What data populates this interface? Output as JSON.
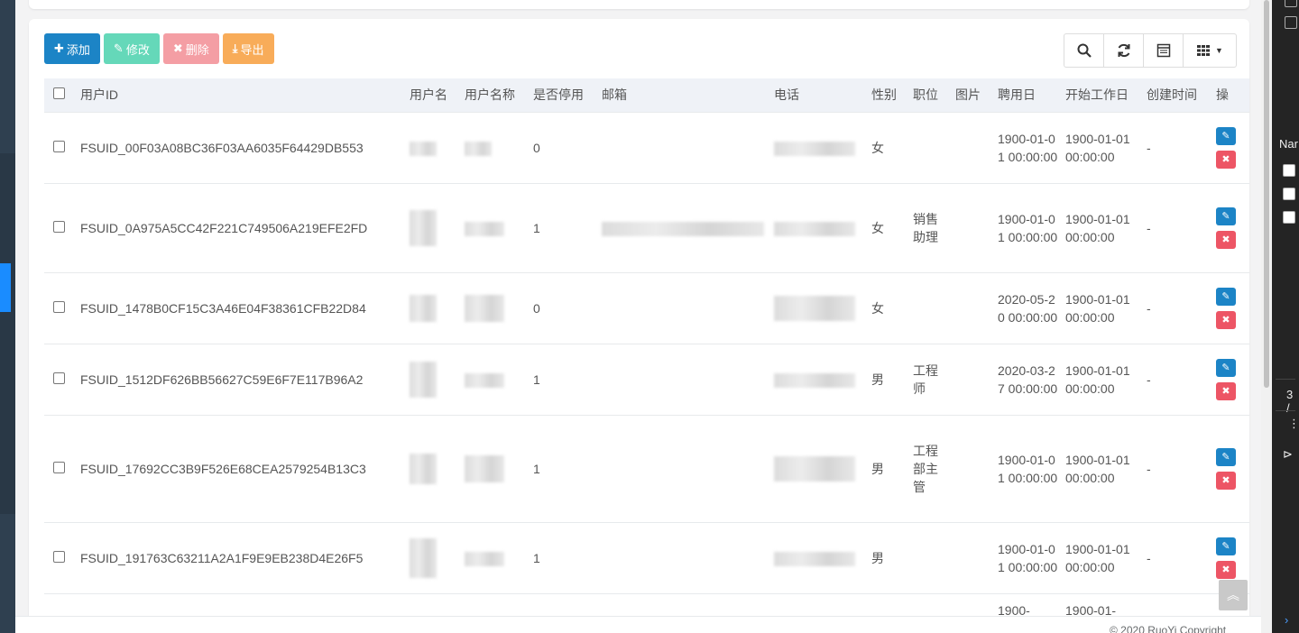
{
  "toolbar": {
    "add_label": "添加",
    "edit_label": "修改",
    "delete_label": "删除",
    "export_label": "导出"
  },
  "columns": [
    "用户ID",
    "用户名",
    "用户名称",
    "是否停用",
    "邮箱",
    "电话",
    "性别",
    "职位",
    "图片",
    "聘用日",
    "开始工作日",
    "创建时间",
    "操"
  ],
  "rows": [
    {
      "id": "FSUID_00F03A08BC36F03AA6035F64429DB553",
      "disabled": "0",
      "gender": "女",
      "position": "",
      "hire": "1900-01-01 00:00:00",
      "start": "1900-01-01 00:00:00",
      "created": "-"
    },
    {
      "id": "FSUID_0A975A5CC42F221C749506A219EFE2FD",
      "disabled": "1",
      "gender": "女",
      "position": "销售助理",
      "hire": "1900-01-01 00:00:00",
      "start": "1900-01-01 00:00:00",
      "created": "-"
    },
    {
      "id": "FSUID_1478B0CF15C3A46E04F38361CFB22D84",
      "disabled": "0",
      "gender": "女",
      "position": "",
      "hire": "2020-05-20 00:00:00",
      "start": "1900-01-01 00:00:00",
      "created": "-"
    },
    {
      "id": "FSUID_1512DF626BB56627C59E6F7E117B96A2",
      "disabled": "1",
      "gender": "男",
      "position": "工程师",
      "hire": "2020-03-27 00:00:00",
      "start": "1900-01-01 00:00:00",
      "created": "-"
    },
    {
      "id": "FSUID_17692CC3B9F526E68CEA2579254B13C3",
      "disabled": "1",
      "gender": "男",
      "position": "工程部主管",
      "hire": "1900-01-01 00:00:00",
      "start": "1900-01-01 00:00:00",
      "created": "-"
    },
    {
      "id": "FSUID_191763C63211A2A1F9E9EB238D4E26F5",
      "disabled": "1",
      "gender": "男",
      "position": "",
      "hire": "1900-01-01 00:00:00",
      "start": "1900-01-01 00:00:00",
      "created": "-"
    },
    {
      "id": "",
      "disabled": "",
      "gender": "",
      "position": "",
      "hire": "1900-",
      "start": "1900-01-",
      "created": ""
    }
  ],
  "footer": {
    "text": "© 2020 RuoYi Copyright"
  },
  "devtools": {
    "label1": "Nar",
    "label2": "3 /"
  }
}
